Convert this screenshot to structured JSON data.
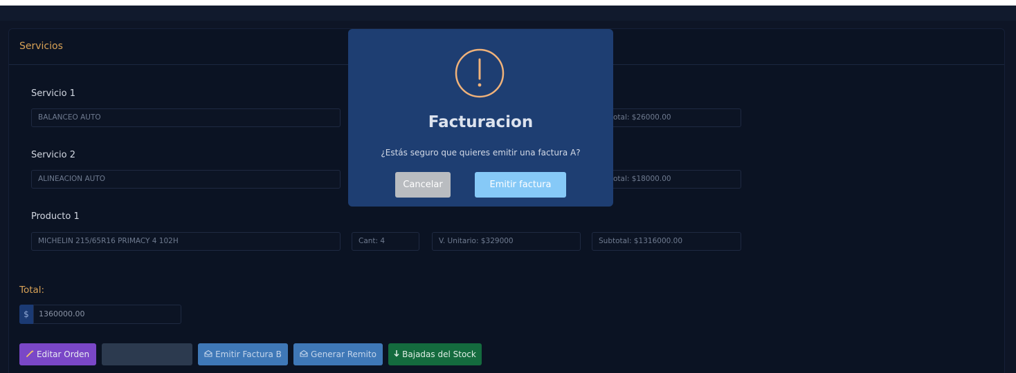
{
  "card": {
    "title": "Servicios"
  },
  "items": [
    {
      "label": "Servicio 1",
      "description": "BALANCEO AUTO",
      "subtotal": "otal: $26000.00"
    },
    {
      "label": "Servicio 2",
      "description": "ALINEACION AUTO",
      "subtotal": "otal: $18000.00"
    },
    {
      "label": "Producto 1",
      "description": "MICHELIN 215/65R16 PRIMACY 4 102H",
      "quantity": "Cant: 4",
      "unit_price": "V. Unitario: $329000",
      "subtotal": "Subtotal: $1316000.00"
    }
  ],
  "total": {
    "label": "Total:",
    "currency": "$",
    "value": "1360000.00"
  },
  "buttons": {
    "edit": "Editar Orden",
    "invoice_b": "Emitir Factura B",
    "remito": "Generar Remito",
    "stock": "Bajadas del Stock"
  },
  "modal": {
    "title": "Facturacion",
    "message": "¿Estás seguro que quieres emitir una factura A?",
    "cancel": "Cancelar",
    "confirm": "Emitir factura",
    "icon": "warning-circle-icon",
    "icon_color": "#f0b27a"
  },
  "colors": {
    "accent": "#d9a256",
    "modal_bg": "#1e3e72",
    "edit_button": "#7a47c7",
    "primary_button": "#3f78b7",
    "success_button": "#146b3e"
  }
}
